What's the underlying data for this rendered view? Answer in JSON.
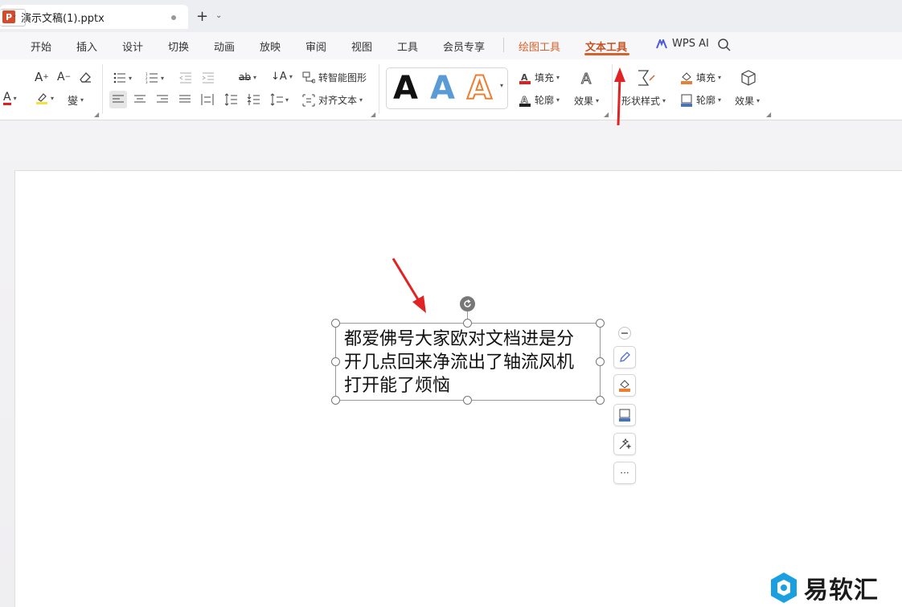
{
  "titlebar": {
    "logo_letter": "P",
    "doc_name": "演示文稿(1).pptx",
    "new_tab": "+",
    "new_tab_caret": "⌄"
  },
  "menu": {
    "items": [
      "开始",
      "插入",
      "设计",
      "切换",
      "动画",
      "放映",
      "审阅",
      "视图",
      "工具",
      "会员专享"
    ],
    "draw_tool": "绘图工具",
    "text_tool": "文本工具",
    "wps_ai": "WPS AI"
  },
  "ribbon": {
    "convert_smart": "转智能图形",
    "align_text": "对齐文本",
    "wordart_letter": "A",
    "fill": "填充",
    "outline": "轮廓",
    "effect": "效果",
    "shape_style": "形状样式",
    "shape_fill": "填充",
    "shape_outline": "轮廓",
    "shape_effect": "效果",
    "font_grow": "A",
    "font_shrink": "A",
    "font_color_glyph": "A",
    "pinyin_glyph": "燮",
    "strike_glyph": "ab",
    "dir_glyph": "A"
  },
  "colors": {
    "accent": "#d4622a",
    "font_color": "#e02020",
    "highlight": "#f5e23a",
    "wordart_blue": "#5b9bd5",
    "wordart_orange": "#ed7d31",
    "arrow_red": "#e02424"
  },
  "slide": {
    "text_lines": [
      "都爱佛号大家欧对文档进是分",
      "开几点回来净流出了轴流风机",
      "打开能了烦恼"
    ]
  },
  "float_tools": {
    "more": "···"
  },
  "watermark": {
    "text": "易软汇"
  }
}
